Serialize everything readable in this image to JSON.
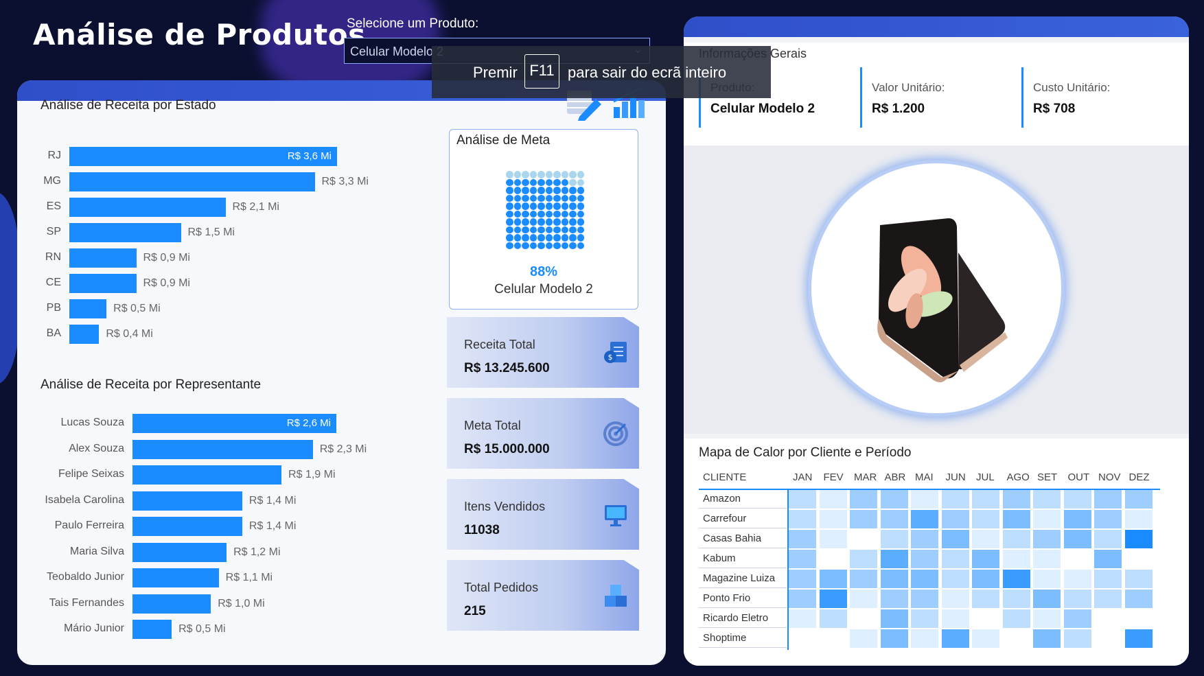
{
  "header": {
    "title": "Análise de Produtos",
    "selector_label": "Selecione um Produto:",
    "selector_value": "Celular Modelo 2"
  },
  "fullscreen_toast": {
    "prefix": "Premir",
    "key": "F11",
    "suffix": "para sair do ecrã inteiro"
  },
  "chart_data": [
    {
      "type": "bar",
      "orientation": "horizontal",
      "title": "Análise de Receita por Estado",
      "categories": [
        "RJ",
        "MG",
        "ES",
        "SP",
        "RN",
        "CE",
        "PB",
        "BA"
      ],
      "values": [
        3.6,
        3.3,
        2.1,
        1.5,
        0.9,
        0.9,
        0.5,
        0.4
      ],
      "labels": [
        "R$ 3,6 Mi",
        "R$ 3,3 Mi",
        "R$ 2,1 Mi",
        "R$ 1,5 Mi",
        "R$ 0,9 Mi",
        "R$ 0,9 Mi",
        "R$ 0,5 Mi",
        "R$ 0,4 Mi"
      ],
      "unit": "R$ Mi"
    },
    {
      "type": "bar",
      "orientation": "horizontal",
      "title": "Análise de Receita por Representante",
      "categories": [
        "Lucas Souza",
        "Alex Souza",
        "Felipe Seixas",
        "Isabela Carolina",
        "Paulo Ferreira",
        "Maria Silva",
        "Teobaldo Junior",
        "Tais Fernandes",
        "Mário Junior"
      ],
      "values": [
        2.6,
        2.3,
        1.9,
        1.4,
        1.4,
        1.2,
        1.1,
        1.0,
        0.5
      ],
      "labels": [
        "R$ 2,6 Mi",
        "R$ 2,3 Mi",
        "R$ 1,9 Mi",
        "R$ 1,4 Mi",
        "R$ 1,4 Mi",
        "R$ 1,2 Mi",
        "R$ 1,1 Mi",
        "R$ 1,0 Mi",
        "R$ 0,5 Mi"
      ],
      "unit": "R$ Mi"
    },
    {
      "type": "heatmap",
      "title": "Mapa de Calor por Cliente e Período",
      "row_header": "CLIENTE",
      "columns": [
        "JAN",
        "FEV",
        "MAR",
        "ABR",
        "MAI",
        "JUN",
        "JUL",
        "AGO",
        "SET",
        "OUT",
        "NOV",
        "DEZ"
      ],
      "rows": [
        "Amazon",
        "Carrefour",
        "Casas Bahia",
        "Kabum",
        "Magazine Luiza",
        "Ponto Frio",
        "Ricardo Eletro",
        "Shoptime"
      ],
      "values": [
        [
          2,
          1,
          3,
          3,
          1,
          2,
          2,
          3,
          2,
          2,
          3,
          3
        ],
        [
          2,
          1,
          3,
          3,
          5,
          3,
          2,
          4,
          1,
          4,
          3,
          1
        ],
        [
          3,
          1,
          0,
          2,
          3,
          4,
          1,
          2,
          3,
          4,
          2,
          7
        ],
        [
          3,
          0,
          2,
          5,
          3,
          2,
          4,
          1,
          1,
          0,
          4,
          0
        ],
        [
          3,
          4,
          3,
          4,
          4,
          2,
          4,
          6,
          1,
          1,
          2,
          2
        ],
        [
          3,
          6,
          1,
          3,
          3,
          1,
          2,
          2,
          4,
          2,
          2,
          3
        ],
        [
          1,
          2,
          0,
          4,
          2,
          1,
          0,
          2,
          1,
          3,
          0,
          0
        ],
        [
          0,
          0,
          1,
          4,
          1,
          5,
          1,
          0,
          4,
          2,
          0,
          6
        ]
      ]
    },
    {
      "type": "waffle",
      "title": "Análise de Meta",
      "value_percent": 88,
      "label": "88%",
      "category": "Celular Modelo 2"
    }
  ],
  "kpis": [
    {
      "label": "Receita Total",
      "value": "R$ 13.245.600",
      "icon": "money-document-icon"
    },
    {
      "label": "Meta Total",
      "value": "R$ 15.000.000",
      "icon": "target-icon"
    },
    {
      "label": "Itens Vendidos",
      "value": "11038",
      "icon": "monitor-icon"
    },
    {
      "label": "Total Pedidos",
      "value": "215",
      "icon": "boxes-icon"
    }
  ],
  "info": {
    "title": "Informações Gerais",
    "produto_label": "Produto:",
    "produto_value": "Celular Modelo 2",
    "valor_label": "Valor Unitário:",
    "valor_value": "R$ 1.200",
    "custo_label": "Custo Unitário:",
    "custo_value": "R$ 708"
  },
  "colors": {
    "bar": "#1a8cff",
    "accent": "#2f4fc9",
    "heat_low": "#ffffff",
    "heat_high": "#1a8cff"
  }
}
